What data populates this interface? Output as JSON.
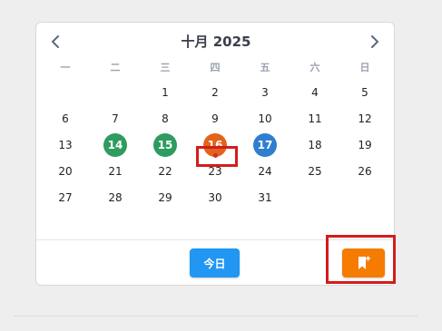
{
  "calendar": {
    "title": "十月 2025",
    "weekdays": [
      "一",
      "二",
      "三",
      "四",
      "五",
      "六",
      "日"
    ],
    "weeks": [
      [
        "",
        "",
        "1",
        "2",
        "3",
        "4",
        "5"
      ],
      [
        "6",
        "7",
        "8",
        "9",
        "10",
        "11",
        "12"
      ],
      [
        "13",
        "14",
        "15",
        "16",
        "17",
        "18",
        "19"
      ],
      [
        "20",
        "21",
        "22",
        "23",
        "24",
        "25",
        "26"
      ],
      [
        "27",
        "28",
        "29",
        "30",
        "31",
        "",
        ""
      ]
    ],
    "marked_days": {
      "14": "#2e9b5f",
      "15": "#2e9b5f",
      "16": "#e2641a",
      "17": "#2f7fd0"
    },
    "dot_days": {
      "16": "#c9302c"
    },
    "prev_icon": "chevron-left-icon",
    "next_icon": "chevron-right-icon"
  },
  "footer": {
    "today_label": "今日",
    "today_color": "#2196f3",
    "bookmark_icon": "bookmark-add-icon",
    "bookmark_color": "#f57c00"
  },
  "annotations": {
    "highlight_color": "#d41c1c"
  }
}
